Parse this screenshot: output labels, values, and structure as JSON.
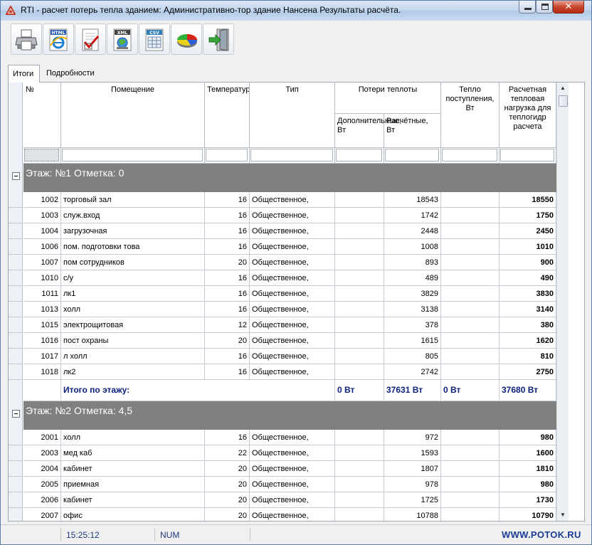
{
  "window": {
    "title": "RTI - расчет потерь тепла зданием: Административно-тор здание Нансена Результаты расчёта."
  },
  "toolbar": {
    "buttons": [
      {
        "name": "print-button",
        "icon": "printer-icon",
        "badge": ""
      },
      {
        "name": "export-html-button",
        "icon": "ie-html-icon",
        "badge": "HTML"
      },
      {
        "name": "checklist-button",
        "icon": "checklist-icon",
        "badge": ""
      },
      {
        "name": "export-xml-button",
        "icon": "xml-icon",
        "badge": "XML"
      },
      {
        "name": "export-csv-button",
        "icon": "csv-icon",
        "badge": "CSV"
      },
      {
        "name": "chart-button",
        "icon": "pie-chart-icon",
        "badge": ""
      },
      {
        "name": "exit-button",
        "icon": "exit-door-icon",
        "badge": ""
      }
    ]
  },
  "tabs": [
    {
      "label": "Итоги",
      "active": true
    },
    {
      "label": "Подробности",
      "active": false
    }
  ],
  "grid": {
    "headers": {
      "num": "№",
      "room": "Помещение",
      "temp": "Температур",
      "type": "Тип",
      "losses_group": "Потери теплоты",
      "additional": "Дополнительные, Вт",
      "calculated": "Расчётные, Вт",
      "heat_gain": "Тепло поступления, Вт",
      "design_load": "Расчетная тепловая нагрузка для теплогидр расчета"
    },
    "floors": [
      {
        "label": "Этаж:  №1 Отметка: 0",
        "rows": [
          {
            "num": "1002",
            "room": "торговый зал",
            "temp": "16",
            "type": "Общественное,",
            "add": "",
            "calc": "18543",
            "gain": "",
            "load": "18550"
          },
          {
            "num": "1003",
            "room": "служ.вход",
            "temp": "16",
            "type": "Общественное,",
            "add": "",
            "calc": "1742",
            "gain": "",
            "load": "1750"
          },
          {
            "num": "1004",
            "room": "загрузочная",
            "temp": "16",
            "type": "Общественное,",
            "add": "",
            "calc": "2448",
            "gain": "",
            "load": "2450"
          },
          {
            "num": "1006",
            "room": "пом. подготовки това",
            "temp": "16",
            "type": "Общественное,",
            "add": "",
            "calc": "1008",
            "gain": "",
            "load": "1010"
          },
          {
            "num": "1007",
            "room": "пом сотрудников",
            "temp": "20",
            "type": "Общественное,",
            "add": "",
            "calc": "893",
            "gain": "",
            "load": "900"
          },
          {
            "num": "1010",
            "room": "с/у",
            "temp": "16",
            "type": "Общественное,",
            "add": "",
            "calc": "489",
            "gain": "",
            "load": "490"
          },
          {
            "num": "1011",
            "room": "лк1",
            "temp": "16",
            "type": "Общественное,",
            "add": "",
            "calc": "3829",
            "gain": "",
            "load": "3830"
          },
          {
            "num": "1013",
            "room": "холл",
            "temp": "16",
            "type": "Общественное,",
            "add": "",
            "calc": "3138",
            "gain": "",
            "load": "3140"
          },
          {
            "num": "1015",
            "room": "электрощитовая",
            "temp": "12",
            "type": "Общественное,",
            "add": "",
            "calc": "378",
            "gain": "",
            "load": "380"
          },
          {
            "num": "1016",
            "room": "пост охраны",
            "temp": "20",
            "type": "Общественное,",
            "add": "",
            "calc": "1615",
            "gain": "",
            "load": "1620"
          },
          {
            "num": "1017",
            "room": "л холл",
            "temp": "16",
            "type": "Общественное,",
            "add": "",
            "calc": "805",
            "gain": "",
            "load": "810"
          },
          {
            "num": "1018",
            "room": "лк2",
            "temp": "16",
            "type": "Общественное,",
            "add": "",
            "calc": "2742",
            "gain": "",
            "load": "2750"
          }
        ],
        "total": {
          "label": "Итого по этажу:",
          "add": "0 Вт",
          "calc": "37631 Вт",
          "gain": "0 Вт",
          "load": "37680 Вт"
        }
      },
      {
        "label": "Этаж:  №2 Отметка: 4,5",
        "rows": [
          {
            "num": "2001",
            "room": "холл",
            "temp": "16",
            "type": "Общественное,",
            "add": "",
            "calc": "972",
            "gain": "",
            "load": "980"
          },
          {
            "num": "2003",
            "room": "мед каб",
            "temp": "22",
            "type": "Общественное,",
            "add": "",
            "calc": "1593",
            "gain": "",
            "load": "1600"
          },
          {
            "num": "2004",
            "room": "кабинет",
            "temp": "20",
            "type": "Общественное,",
            "add": "",
            "calc": "1807",
            "gain": "",
            "load": "1810"
          },
          {
            "num": "2005",
            "room": "приемная",
            "temp": "20",
            "type": "Общественное,",
            "add": "",
            "calc": "978",
            "gain": "",
            "load": "980"
          },
          {
            "num": "2006",
            "room": "кабинет",
            "temp": "20",
            "type": "Общественное,",
            "add": "",
            "calc": "1725",
            "gain": "",
            "load": "1730"
          },
          {
            "num": "2007",
            "room": "офис",
            "temp": "20",
            "type": "Общественное,",
            "add": "",
            "calc": "10788",
            "gain": "",
            "load": "10790"
          }
        ]
      }
    ]
  },
  "statusbar": {
    "time": "15:25:12",
    "num": "NUM",
    "url": "WWW.POTOK.RU"
  }
}
